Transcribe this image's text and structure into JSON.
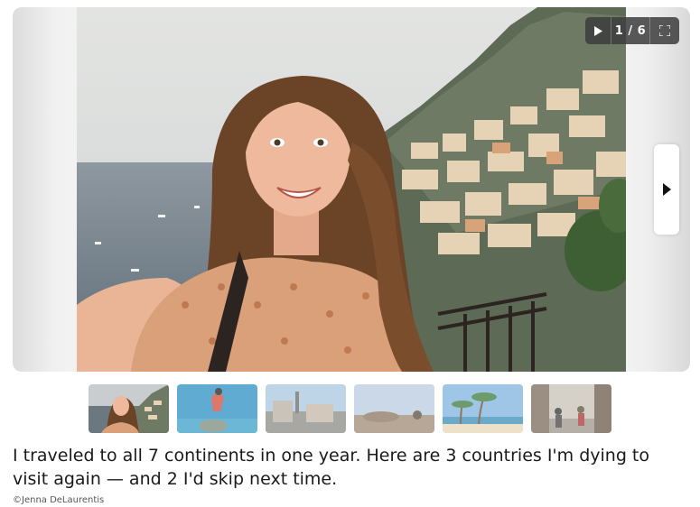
{
  "slideshow": {
    "counter": "1 / 6",
    "play_icon": "play-icon",
    "fullscreen_icon": "fullscreen-icon",
    "next_icon": "chevron-right-icon"
  },
  "thumbnails": [
    {
      "subject": "selfie-coast"
    },
    {
      "subject": "diver-underwater"
    },
    {
      "subject": "city-street"
    },
    {
      "subject": "sky-landscape"
    },
    {
      "subject": "palm-beach"
    },
    {
      "subject": "market-street"
    }
  ],
  "article": {
    "headline": "I traveled to all 7 continents in one year. Here are 3 countries I'm dying to visit again — and 2 I'd skip next time.",
    "credit": "©Jenna DeLaurentis"
  }
}
